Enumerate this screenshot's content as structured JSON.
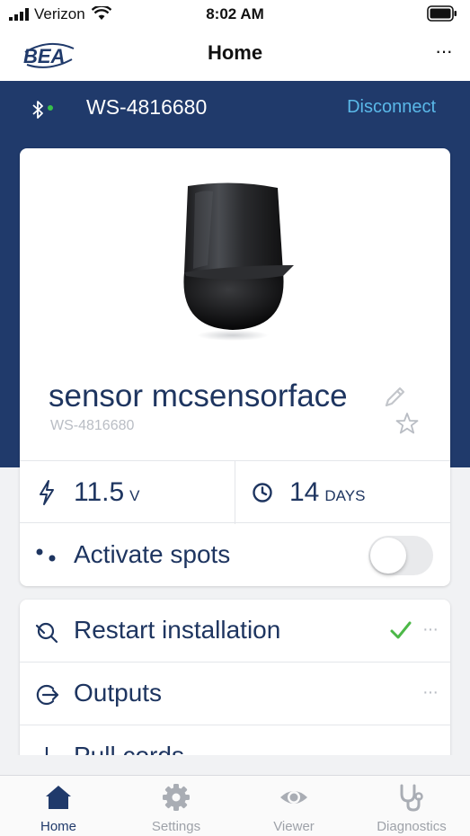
{
  "status_bar": {
    "carrier": "Verizon",
    "time": "8:02 AM"
  },
  "navbar": {
    "logo_text": "BEA",
    "title": "Home",
    "more": "···"
  },
  "connection": {
    "device_id": "WS-4816680",
    "disconnect_label": "Disconnect",
    "status_color": "#38c04a"
  },
  "sensor": {
    "name": "sensor mcsensorface",
    "serial": "WS-4816680",
    "voltage_value": "11.5",
    "voltage_unit": "V",
    "days_value": "14",
    "days_unit": "DAYS",
    "activate_spots_label": "Activate spots",
    "activate_spots_on": false
  },
  "list": {
    "items": [
      {
        "label": "Restart installation",
        "icon": "restart-icon",
        "completed": true,
        "more": "···"
      },
      {
        "label": "Outputs",
        "icon": "outputs-icon",
        "more": "···"
      },
      {
        "label": "Pull cords",
        "icon": "pull-cords-icon"
      }
    ]
  },
  "tabs": [
    {
      "label": "Home",
      "icon": "home-icon",
      "active": true
    },
    {
      "label": "Settings",
      "icon": "gear-icon"
    },
    {
      "label": "Viewer",
      "icon": "eye-icon"
    },
    {
      "label": "Diagnostics",
      "icon": "stethoscope-icon"
    }
  ],
  "colors": {
    "brand_navy": "#203a6b",
    "link_blue": "#5ab8e8",
    "success_green": "#4cb848"
  }
}
